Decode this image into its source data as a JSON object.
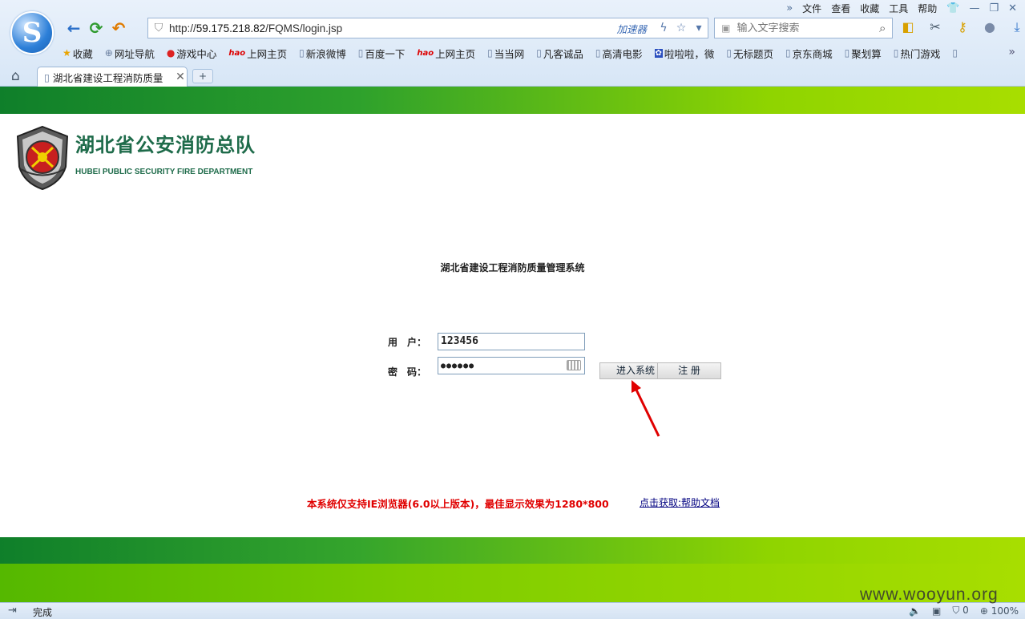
{
  "browser": {
    "menu": [
      "文件",
      "查看",
      "收藏",
      "工具",
      "帮助"
    ],
    "url_prefix": "http://",
    "url_host": "59.175.218.82",
    "url_path": "/FQMS/login.jsp",
    "accelerator_label": "加速器",
    "search_placeholder": "输入文字搜索",
    "bookmarks": [
      "收藏",
      "网址导航",
      "游戏中心",
      "上网主页",
      "新浪微博",
      "百度一下",
      "上网主页",
      "当当网",
      "凡客诚品",
      "高清电影",
      "啦啦啦，微",
      "无标题页",
      "京东商城",
      "聚划算",
      "热门游戏"
    ],
    "tab_title": "湖北省建设工程消防质量",
    "status_text": "完成",
    "status_count": "0",
    "zoom": "100%"
  },
  "header": {
    "org_name_cn": "湖北省公安消防总队",
    "org_name_en": "HUBEI PUBLIC SECURITY FIRE DEPARTMENT"
  },
  "login": {
    "system_title": "湖北省建设工程消防质量管理系统",
    "user_label": "用　户：",
    "user_value": "123456",
    "password_label": "密　码：",
    "password_value": "●●●●●●",
    "enter_button": "进入系统",
    "register_button": "注 册"
  },
  "footer": {
    "notice": "本系统仅支持IE浏览器(6.0以上版本)，最佳显示效果为1280*800",
    "help_link": "点击获取:帮助文档"
  },
  "watermark": "www.wooyun.org",
  "colors": {
    "accent_red": "#e00000",
    "brand_green": "#1e6b4a",
    "arrow_red": "#e00000"
  }
}
